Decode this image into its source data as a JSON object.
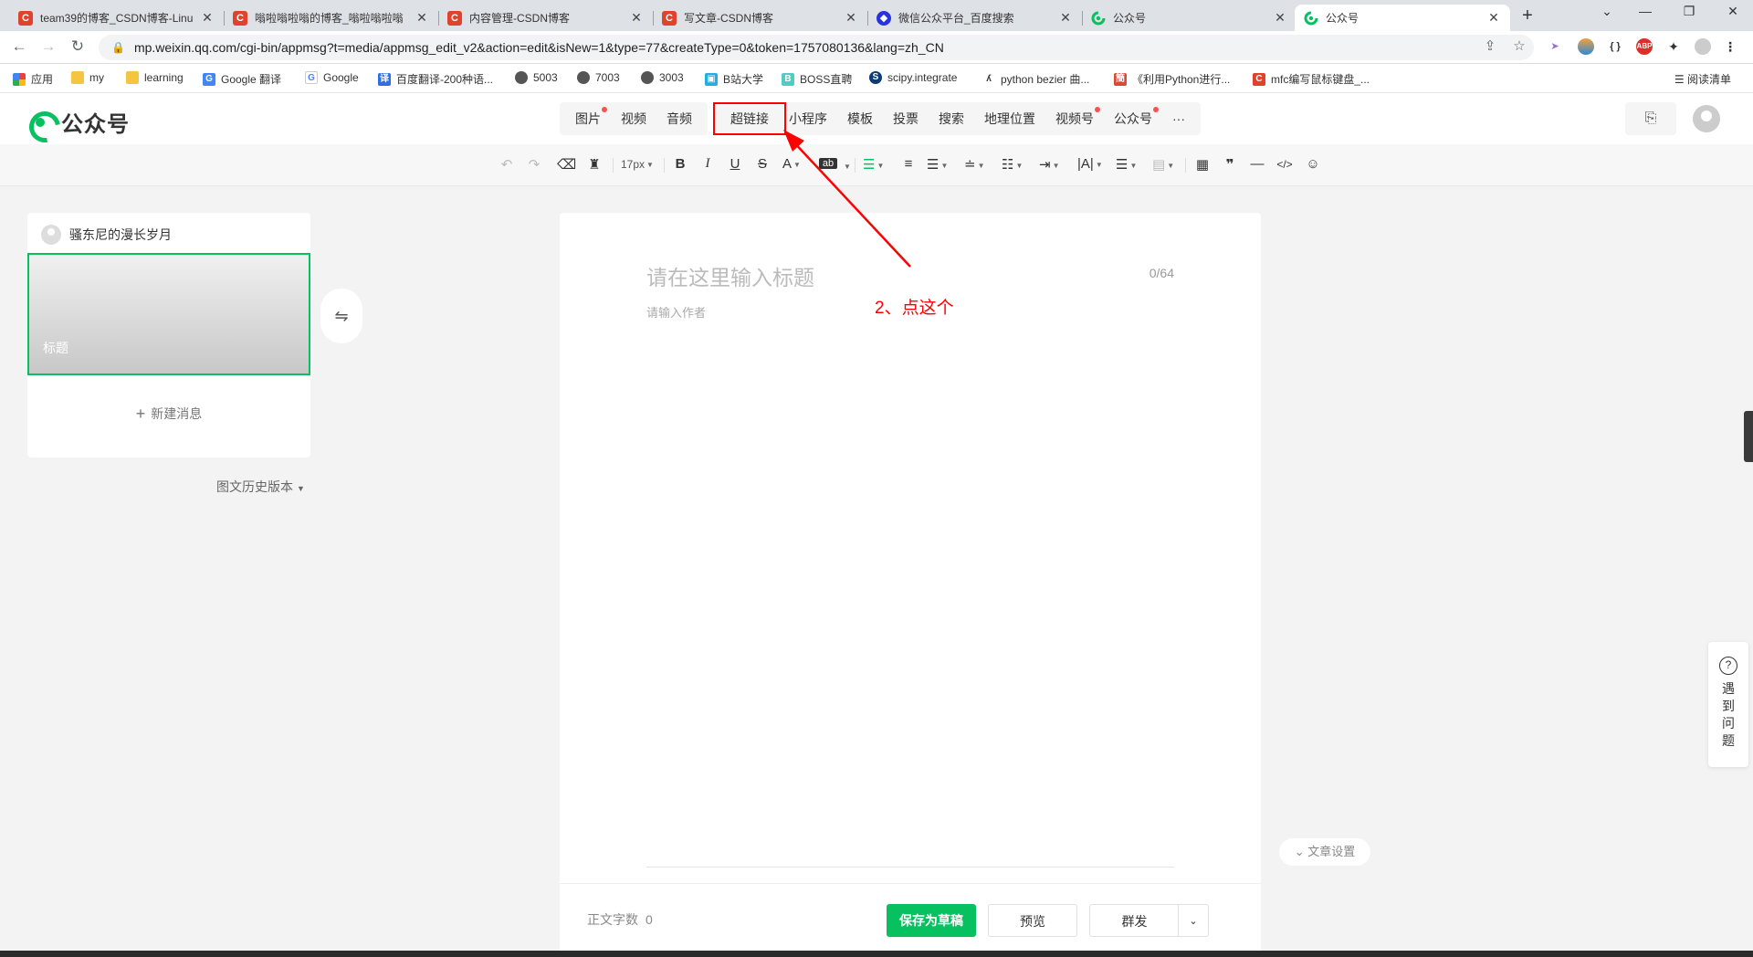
{
  "tabs": [
    {
      "title": "team39的博客_CSDN博客-Linu",
      "favicon": "csdn",
      "active": false
    },
    {
      "title": "嗡啦嗡啦嗡的博客_嗡啦嗡啦嗡",
      "favicon": "csdn",
      "active": false
    },
    {
      "title": "内容管理-CSDN博客",
      "favicon": "csdn",
      "active": false
    },
    {
      "title": "写文章-CSDN博客",
      "favicon": "csdn",
      "active": false
    },
    {
      "title": "微信公众平台_百度搜索",
      "favicon": "baidu",
      "active": false
    },
    {
      "title": "公众号",
      "favicon": "wx",
      "active": false
    },
    {
      "title": "公众号",
      "favicon": "wx",
      "active": true
    }
  ],
  "address": {
    "url": "mp.weixin.qq.com/cgi-bin/appmsg?t=media/appmsg_edit_v2&action=edit&isNew=1&type=77&createType=0&token=1757080136&lang=zh_CN"
  },
  "bookmarks": [
    {
      "label": "应用",
      "icon": "apps-grid-icon"
    },
    {
      "label": "my",
      "icon": "folder-icon"
    },
    {
      "label": "learning",
      "icon": "folder-icon"
    },
    {
      "label": "Google 翻译",
      "icon": "google-translate-icon"
    },
    {
      "label": "Google",
      "icon": "google-icon"
    },
    {
      "label": "百度翻译-200种语...",
      "icon": "baidu-translate-icon"
    },
    {
      "label": "5003",
      "icon": "globe-icon"
    },
    {
      "label": "7003",
      "icon": "globe-icon"
    },
    {
      "label": "3003",
      "icon": "globe-icon"
    },
    {
      "label": "B站大学",
      "icon": "bilibili-icon"
    },
    {
      "label": "BOSS直聘",
      "icon": "boss-icon"
    },
    {
      "label": "scipy.integrate",
      "icon": "scipy-icon"
    },
    {
      "label": "python bezier 曲...",
      "icon": "python-icon"
    },
    {
      "label": "《利用Python进行...",
      "icon": "book-icon"
    },
    {
      "label": "mfc编写鼠标键盘_...",
      "icon": "csdn-icon"
    }
  ],
  "reading_list": "阅读清单",
  "app": {
    "logo_text": "公众号"
  },
  "insert_groups": [
    [
      {
        "label": "图片",
        "dot": true
      },
      {
        "label": "视频",
        "dot": false
      },
      {
        "label": "音频",
        "dot": false
      }
    ],
    [
      {
        "label": "超链接",
        "dot": false,
        "highlight": true
      },
      {
        "label": "小程序",
        "dot": false
      },
      {
        "label": "模板",
        "dot": false
      },
      {
        "label": "投票",
        "dot": false
      },
      {
        "label": "搜索",
        "dot": false
      },
      {
        "label": "地理位置",
        "dot": false
      },
      {
        "label": "视频号",
        "dot": true
      },
      {
        "label": "公众号",
        "dot": true
      },
      {
        "label": "···",
        "dot": false
      }
    ]
  ],
  "toolbar": {
    "font_size": "17px"
  },
  "left_panel": {
    "account_name": "骚东尼的漫长岁月",
    "cover_title": "标题",
    "new_message": "新建消息",
    "history": "图文历史版本"
  },
  "editor": {
    "title_placeholder": "请在这里输入标题",
    "title_count": "0/64",
    "author_placeholder": "请输入作者",
    "word_count_label": "正文字数",
    "word_count": "0",
    "save_draft": "保存为草稿",
    "preview": "预览",
    "mass_send": "群发"
  },
  "article_settings": "文章设置",
  "help_text": [
    "遇",
    "到",
    "问",
    "题"
  ],
  "annotation": "2、点这个",
  "colors": {
    "brand_green": "#07c160",
    "annotation_red": "#ff0000",
    "dot_red": "#fa5151"
  }
}
